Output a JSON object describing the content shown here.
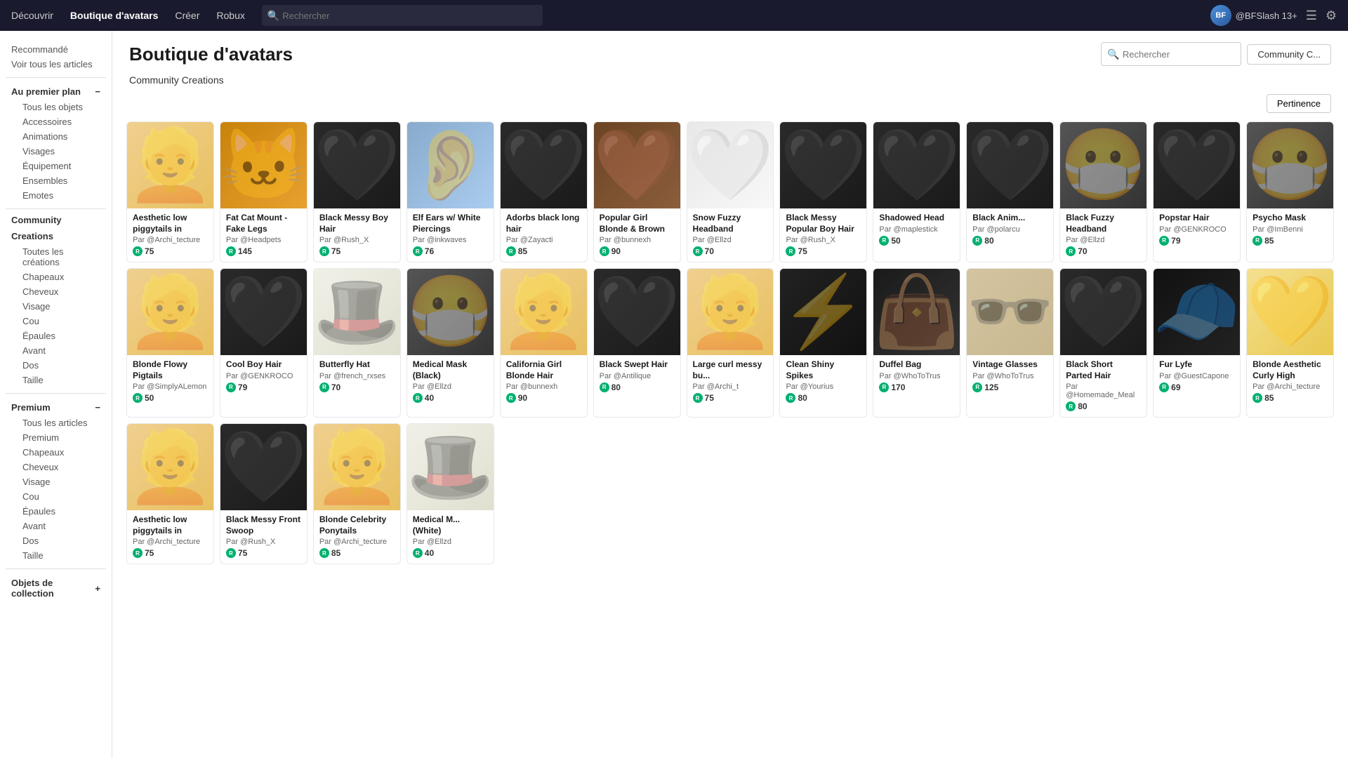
{
  "topnav": {
    "items": [
      "Découvrir",
      "Boutique d'avatars",
      "Créer",
      "Robux"
    ],
    "search_placeholder": "Rechercher",
    "user": "@BFSlash 13+"
  },
  "page": {
    "title": "Boutique d'avatars",
    "search_placeholder": "Rechercher",
    "community_btn": "Community C..."
  },
  "section_label": "Community Creations",
  "filter": {
    "label": "Pertinence"
  },
  "sidebar": {
    "recommended": "Recommandé",
    "see_all": "Voir tous les articles",
    "au_premier_plan": "Au premier plan",
    "collapse": "−",
    "items_fp": [
      "Tous les objets",
      "Accessoires",
      "Animations",
      "Visages",
      "Équipement",
      "Ensembles",
      "Emotes"
    ],
    "community_label": "Community",
    "creations_label": "Creations",
    "items_cr": [
      "Toutes les créations",
      "Chapeaux",
      "Cheveux",
      "Visage",
      "Cou",
      "Épaules",
      "Avant",
      "Dos",
      "Taille"
    ],
    "premium_label": "Premium",
    "collapse2": "−",
    "items_pr": [
      "Tous les articles",
      "Premium",
      "Chapeaux",
      "Cheveux",
      "Visage",
      "Cou",
      "Épaules",
      "Avant",
      "Dos",
      "Taille"
    ],
    "collectibles": "Objets de collection",
    "expand": "+"
  },
  "items": [
    {
      "name": "Aesthetic low piggytails in",
      "creator": "@Archi_tecture",
      "price": 75,
      "img": "hair-light"
    },
    {
      "name": "Fat Cat Mount - Fake Legs",
      "creator": "@Headpets",
      "price": 145,
      "img": "animal"
    },
    {
      "name": "Black Messy Boy Hair",
      "creator": "@Rush_X",
      "price": 75,
      "img": "hair-black"
    },
    {
      "name": "Elf Ears w/ White Piercings",
      "creator": "@inkwaves",
      "price": 76,
      "img": "misc"
    },
    {
      "name": "Adorbs black long hair",
      "creator": "@Zayacti",
      "price": 85,
      "img": "hair-black"
    },
    {
      "name": "Popular Girl Blonde & Brown",
      "creator": "@bunnexh",
      "price": 90,
      "img": "hair-brown"
    },
    {
      "name": "Snow Fuzzy Headband",
      "creator": "@Ellzd",
      "price": 70,
      "img": "hair-white"
    },
    {
      "name": "Black Messy Popular Boy Hair",
      "creator": "@Rush_X",
      "price": 75,
      "img": "hair-black"
    },
    {
      "name": "Shadowed Head",
      "creator": "@maplestick",
      "price": 50,
      "img": "hair-black"
    },
    {
      "name": "Black Anim...",
      "creator": "@polarcu",
      "price": 80,
      "img": "hair-black"
    },
    {
      "name": "Black Fuzzy Headband",
      "creator": "@Ellzd",
      "price": 70,
      "img": "mask"
    },
    {
      "name": "Popstar Hair",
      "creator": "@GENKROCO",
      "price": 79,
      "img": "hair-black"
    },
    {
      "name": "Psycho Mask",
      "creator": "@ImBenni",
      "price": 85,
      "img": "mask"
    },
    {
      "name": "Blonde Flowy Pigtails",
      "creator": "@SimplyALemon",
      "price": 50,
      "img": "hair-light"
    },
    {
      "name": "Cool Boy Hair",
      "creator": "@GENKROCO",
      "price": 79,
      "img": "hair-black"
    },
    {
      "name": "Butterfly Hat",
      "creator": "@french_rxses",
      "price": 70,
      "img": "hat"
    },
    {
      "name": "Medical Mask (Black)",
      "creator": "@Ellzd",
      "price": 40,
      "img": "mask"
    },
    {
      "name": "California Girl Blonde Hair",
      "creator": "@bunnexh",
      "price": 90,
      "img": "hair-light"
    },
    {
      "name": "Black Swept Hair",
      "creator": "@Antilique",
      "price": 80,
      "img": "hair-black"
    },
    {
      "name": "Large curl messy bu...",
      "creator": "@Archi_t",
      "price": 75,
      "img": "hair-light"
    },
    {
      "name": "Clean Shiny Spikes",
      "creator": "@Yourius",
      "price": 80,
      "img": "spikes"
    },
    {
      "name": "Duffel Bag",
      "creator": "@WhoToTrus",
      "price": 170,
      "img": "bag"
    },
    {
      "name": "Vintage Glasses",
      "creator": "@WhoToTrus",
      "price": 125,
      "img": "glasses"
    },
    {
      "name": "Black Short Parted Hair",
      "creator": "@Homemade_Meal",
      "price": 80,
      "img": "hair-black"
    },
    {
      "name": "Fur Lyfe",
      "creator": "@GuestCapone",
      "price": 69,
      "img": "cap"
    },
    {
      "name": "Blonde Aesthetic Curly High",
      "creator": "@Archi_tecture",
      "price": 85,
      "img": "blonde-curly"
    },
    {
      "name": "Aesthetic low piggytails in",
      "creator": "@Archi_tecture",
      "price": 75,
      "img": "hair-light"
    },
    {
      "name": "Black Messy Front Swoop",
      "creator": "@Rush_X",
      "price": 75,
      "img": "hair-black"
    },
    {
      "name": "Blonde Celebrity Ponytails",
      "creator": "@Archi_tecture",
      "price": 85,
      "img": "hair-light"
    },
    {
      "name": "Medical M... (White)",
      "creator": "@Ellzd",
      "price": 40,
      "img": "hat"
    }
  ]
}
